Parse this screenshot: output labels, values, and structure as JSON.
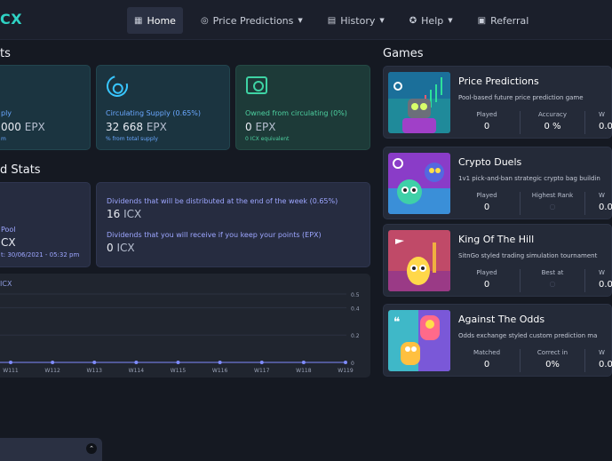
{
  "nav": {
    "logo": "CX",
    "items": [
      {
        "label": "Home",
        "icon": "grid-icon",
        "glyph": "▦",
        "dropdown": false,
        "active": true
      },
      {
        "label": "Price Predictions",
        "icon": "target-icon",
        "glyph": "◎",
        "dropdown": true,
        "active": false
      },
      {
        "label": "History",
        "icon": "clipboard-icon",
        "glyph": "▤",
        "dropdown": true,
        "active": false
      },
      {
        "label": "Help",
        "icon": "lifebuoy-icon",
        "glyph": "✪",
        "dropdown": true,
        "active": false
      },
      {
        "label": "Referral",
        "icon": "gift-icon",
        "glyph": "▣",
        "dropdown": false,
        "active": false
      }
    ]
  },
  "stats": {
    "title": "ts",
    "supply": {
      "label": "ply",
      "value": "000",
      "unit": "EPX",
      "sub": "m"
    },
    "circulating": {
      "label": "Circulating Supply (0.65%)",
      "value": "32 668",
      "unit": "EPX",
      "sub": "% from total supply"
    },
    "owned": {
      "label": "Owned from circulating (0%)",
      "value": "0",
      "unit": "EPX",
      "sub": "0 ICX equivalent"
    }
  },
  "dividend_stats": {
    "title": "d Stats",
    "pool": {
      "label": "Pool",
      "value": "CX",
      "sub": "t: 30/06/2021 - 05:32 pm"
    },
    "distributed": {
      "label": "Dividends that will be distributed at the end of the week (0.65%)",
      "value": "16",
      "unit": "ICX"
    },
    "receive": {
      "label": "Dividends that you will receive if you keep your points (EPX)",
      "value": "0",
      "unit": "ICX"
    }
  },
  "chart_data": {
    "type": "line",
    "title": "ICX",
    "categories": [
      "W111",
      "W112",
      "W113",
      "W114",
      "W115",
      "W116",
      "W117",
      "W118",
      "W119"
    ],
    "values": [
      0,
      0,
      0,
      0,
      0,
      0,
      0,
      0,
      0
    ],
    "yticks": [
      "0",
      "0.2",
      "0.4",
      "0.5"
    ],
    "ylim": [
      0,
      0.5
    ],
    "color": "#7f8cff",
    "grid": true
  },
  "games": {
    "title": "Games",
    "items": [
      {
        "title": "Price Predictions",
        "desc": "Pool-based future price prediction game",
        "cols": [
          {
            "label": "Played",
            "value": "0"
          },
          {
            "label": "Accuracy",
            "value": "0 %"
          },
          {
            "label": "W",
            "value": "0.0"
          }
        ]
      },
      {
        "title": "Crypto Duels",
        "desc": "1v1 pick-and-ban strategic crypto bag buildin",
        "cols": [
          {
            "label": "Played",
            "value": "0"
          },
          {
            "label": "Highest Rank",
            "value": "○"
          },
          {
            "label": "W",
            "value": "0.0"
          }
        ]
      },
      {
        "title": "King Of The Hill",
        "desc": "SitnGo styled trading simulation tournament",
        "cols": [
          {
            "label": "Played",
            "value": "0"
          },
          {
            "label": "Best at",
            "value": "○"
          },
          {
            "label": "W",
            "value": "0.0"
          }
        ]
      },
      {
        "title": "Against The Odds",
        "desc": "Odds exchange styled custom prediction ma",
        "cols": [
          {
            "label": "Matched",
            "value": "0"
          },
          {
            "label": "Correct in",
            "value": "0%"
          },
          {
            "label": "W",
            "value": "0.0"
          }
        ]
      }
    ]
  },
  "footer": {
    "collapse_icon": "chevron-up-icon",
    "collapse_glyph": "⌃"
  }
}
